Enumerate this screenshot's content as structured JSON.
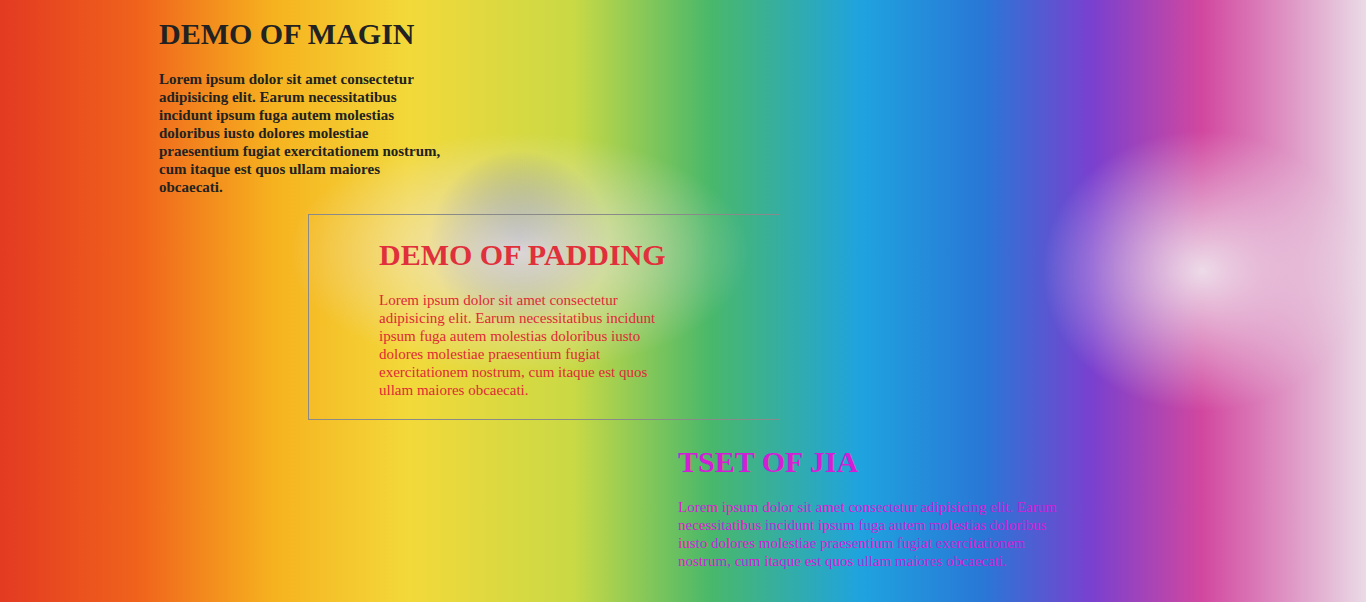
{
  "sections": [
    {
      "kind": "margin",
      "heading": "DEMO OF MAGIN",
      "text": "Lorem ipsum dolor sit amet consectetur adipisicing elit. Earum necessitatibus incidunt ipsum fuga autem molestias doloribus iusto dolores molestiae praesentium fugiat exercitationem nostrum, cum itaque est quos ullam maiores obcaecati."
    },
    {
      "kind": "padding",
      "heading": "DEMO OF PADDING",
      "text": "Lorem ipsum dolor sit amet consectetur adipisicing elit. Earum necessitatibus incidunt ipsum fuga autem molestias doloribus iusto dolores molestiae praesentium fugiat exercitationem nostrum, cum itaque est quos ullam maiores obcaecati."
    },
    {
      "kind": "test",
      "heading": "TSET OF JIA",
      "text": "Lorem ipsum dolor sit amet consectetur adipisicing elit. Earum necessitatibus incidunt ipsum fuga autem molestias doloribus iusto dolores molestiae praesentium fugiat exercitationem nostrum, cum itaque est quos ullam maiores obcaecati."
    }
  ]
}
